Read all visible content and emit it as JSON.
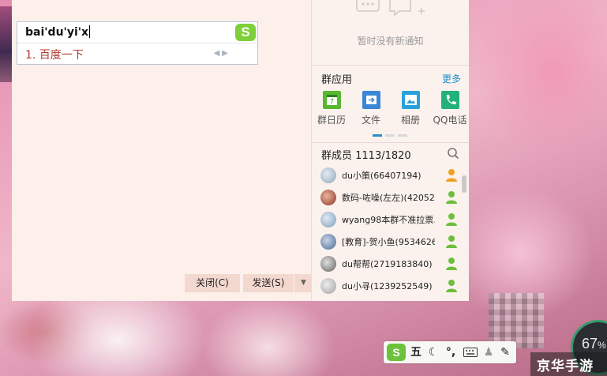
{
  "ime": {
    "composition": "bai'du'yi'x",
    "candidates": [
      "1. 百度一下"
    ],
    "logo": "S"
  },
  "chat": {
    "close_label": "关闭(C)",
    "send_label": "发送(S)"
  },
  "notifications": {
    "empty_text": "暂时没有新通知"
  },
  "group_apps": {
    "title": "群应用",
    "more_label": "更多",
    "items": [
      {
        "label": "群日历",
        "icon": "calendar-icon",
        "color": "#58b830"
      },
      {
        "label": "文件",
        "icon": "file-transfer-icon",
        "color": "#3b86d6"
      },
      {
        "label": "相册",
        "icon": "photo-album-icon",
        "color": "#2aa0d8"
      },
      {
        "label": "QQ电话",
        "icon": "phone-icon",
        "color": "#23b07a"
      }
    ]
  },
  "members": {
    "title": "群成员 1113/1820",
    "list": [
      {
        "name": "du小策(66407194)",
        "role_color": "#f0a020",
        "avatar_color": "#9fb4c6"
      },
      {
        "name": "数码-咗噪(左左)(42052…",
        "role_color": "#6cbf3c",
        "avatar_color": "#b44a3a"
      },
      {
        "name": "wyang98本群不准拉票…",
        "role_color": "#6cbf3c",
        "avatar_color": "#8fb0c8"
      },
      {
        "name": "[教育]-贺小鱼(95346267…",
        "role_color": "#6cbf3c",
        "avatar_color": "#5a78a0"
      },
      {
        "name": "du帮帮(2719183840)",
        "role_color": "#6cbf3c",
        "avatar_color": "#7a7a7a"
      },
      {
        "name": "du小寻(1239252549)",
        "role_color": "#6cbf3c",
        "avatar_color": "#b0b0b0"
      }
    ]
  },
  "ime_toolbar": {
    "logo": "S",
    "mode_label": "五",
    "items": [
      "moon-icon",
      "punctuation-icon",
      "keyboard-icon",
      "user-icon",
      "wrench-icon"
    ]
  },
  "system": {
    "gauge_value": "67",
    "gauge_unit": "%",
    "watermark": "京华手游"
  }
}
